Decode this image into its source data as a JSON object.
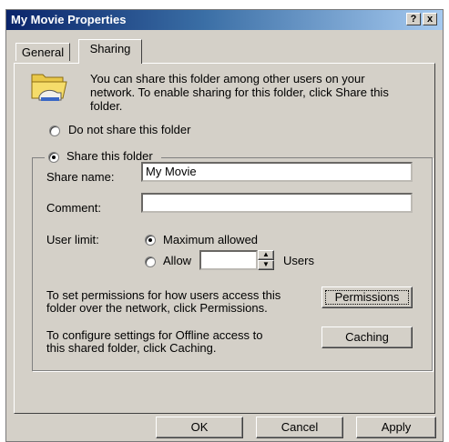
{
  "window": {
    "title": "My Movie Properties"
  },
  "titlebar_buttons": {
    "help": "?",
    "close": "x"
  },
  "tabs": [
    {
      "label": "General"
    },
    {
      "label": "Sharing"
    }
  ],
  "intro": {
    "line1": "You can share this folder among other users on your",
    "line2": "network.  To enable sharing for this folder, click Share this",
    "line3": "folder."
  },
  "share_options": {
    "do_not_share": "Do not share this folder",
    "share": "Share this folder",
    "selected": "share"
  },
  "fields": {
    "share_name_label": "Share name:",
    "share_name_value": "My Movie",
    "comment_label": "Comment:",
    "comment_value": ""
  },
  "user_limit": {
    "label": "User limit:",
    "maximum_label": "Maximum allowed",
    "allow_label": "Allow",
    "users_label": "Users",
    "selected": "maximum",
    "allow_value": ""
  },
  "permissions": {
    "text1": "To set permissions for how users access this",
    "text2": "folder over the network, click Permissions.",
    "button": "Permissions"
  },
  "caching": {
    "text1": "To configure settings for Offline access to",
    "text2": "this shared folder, click Caching.",
    "button": "Caching"
  },
  "footer": {
    "ok": "OK",
    "cancel": "Cancel",
    "apply": "Apply"
  }
}
